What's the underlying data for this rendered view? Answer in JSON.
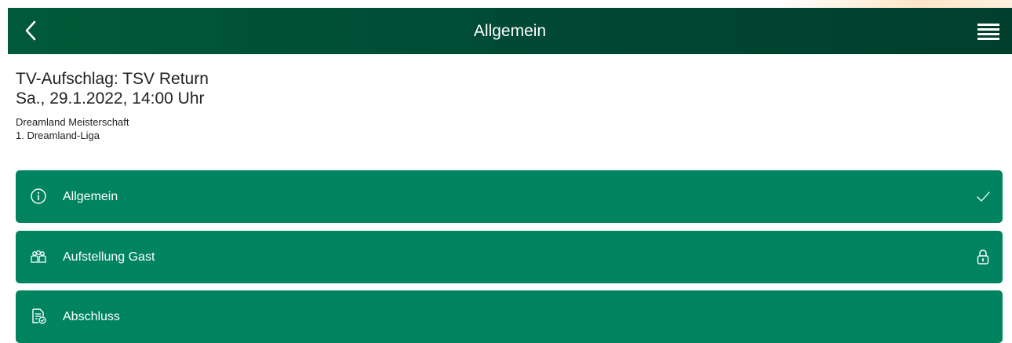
{
  "topbar": {
    "title": "Allgemein",
    "back_icon": "chevron-left-icon",
    "menu_icon": "hamburger-menu-icon",
    "bg_color": "#004733"
  },
  "match": {
    "title": "TV-Aufschlag: TSV Return",
    "date": "Sa., 29.1.2022, 14:00 Uhr",
    "competition": "Dreamland Meisterschaft",
    "league": "1. Dreamland-Liga"
  },
  "sections": [
    {
      "label": "Allgemein",
      "icon": "info-icon",
      "status_icon": "check-icon"
    },
    {
      "label": "Aufstellung Gast",
      "icon": "team-icon",
      "status_icon": "lock-icon"
    },
    {
      "label": "Abschluss",
      "icon": "report-icon",
      "status_icon": ""
    }
  ],
  "colors": {
    "section_bg": "#00845f",
    "text": "#222222"
  }
}
